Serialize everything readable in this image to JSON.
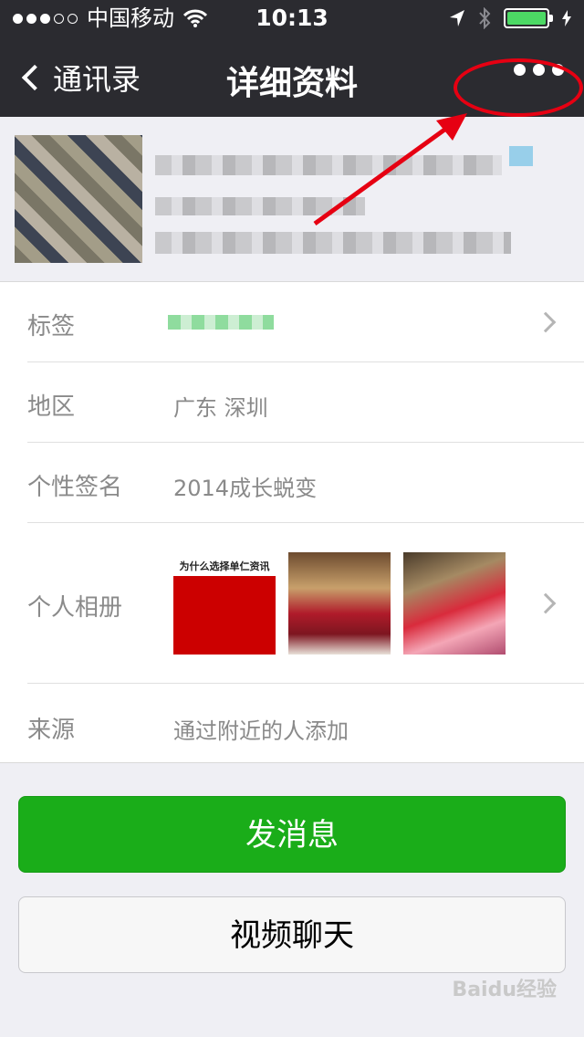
{
  "status_bar": {
    "carrier": "中国移动",
    "time": "10:13",
    "battery_fill": 1.0
  },
  "nav": {
    "back_label": "通讯录",
    "title": "详细资料"
  },
  "details": [
    {
      "key": "tags",
      "label": "标签",
      "value": ""
    },
    {
      "key": "region",
      "label": "地区",
      "value": "广东 深圳"
    },
    {
      "key": "signature",
      "label": "个性签名",
      "value": "2014成长蜕变"
    },
    {
      "key": "album",
      "label": "个人相册",
      "value": ""
    },
    {
      "key": "source",
      "label": "来源",
      "value": "通过附近的人添加"
    }
  ],
  "album": {
    "thumb1_title": "为什么选择单仁资讯"
  },
  "buttons": {
    "send_message": "发消息",
    "video_chat": "视频聊天"
  },
  "watermark": "Baidu经验",
  "colors": {
    "nav_bg": "#2b2b30",
    "primary_green": "#1aad19",
    "annotation_red": "#e60012"
  },
  "icons": [
    "back-chevron-icon",
    "more-dots-icon",
    "wifi-icon",
    "location-icon",
    "bluetooth-icon",
    "battery-icon",
    "row-arrow-icon"
  ]
}
